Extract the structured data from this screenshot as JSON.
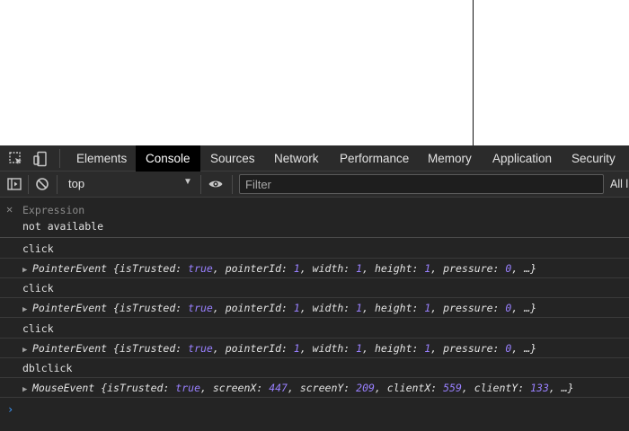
{
  "devtools": {
    "tabs": [
      {
        "label": "Elements",
        "active": false
      },
      {
        "label": "Console",
        "active": true
      },
      {
        "label": "Sources",
        "active": false
      },
      {
        "label": "Network",
        "active": false
      },
      {
        "label": "Performance",
        "active": false
      },
      {
        "label": "Memory",
        "active": false
      },
      {
        "label": "Application",
        "active": false
      },
      {
        "label": "Security",
        "active": false
      }
    ],
    "icons": {
      "inspect": "inspect-element-icon",
      "device": "device-toolbar-icon",
      "sidebar": "show-sidebar-icon",
      "clear": "clear-console-icon",
      "eye": "live-expression-eye-icon"
    }
  },
  "toolbar": {
    "context": "top",
    "filter_placeholder": "Filter",
    "levels_label": "All l"
  },
  "live_expression": {
    "label": "Expression",
    "value": "not available"
  },
  "console": {
    "messages": [
      {
        "text": "click"
      },
      {
        "object": {
          "type": "PointerEvent",
          "open": "{",
          "props": [
            {
              "k": "isTrusted",
              "v": "true"
            },
            {
              "k": "pointerId",
              "v": "1"
            },
            {
              "k": "width",
              "v": "1"
            },
            {
              "k": "height",
              "v": "1"
            },
            {
              "k": "pressure",
              "v": "0"
            }
          ],
          "close": "…}"
        }
      },
      {
        "text": "click"
      },
      {
        "object": {
          "type": "PointerEvent",
          "open": "{",
          "props": [
            {
              "k": "isTrusted",
              "v": "true"
            },
            {
              "k": "pointerId",
              "v": "1"
            },
            {
              "k": "width",
              "v": "1"
            },
            {
              "k": "height",
              "v": "1"
            },
            {
              "k": "pressure",
              "v": "0"
            }
          ],
          "close": "…}"
        }
      },
      {
        "text": "click"
      },
      {
        "object": {
          "type": "PointerEvent",
          "open": "{",
          "props": [
            {
              "k": "isTrusted",
              "v": "true"
            },
            {
              "k": "pointerId",
              "v": "1"
            },
            {
              "k": "width",
              "v": "1"
            },
            {
              "k": "height",
              "v": "1"
            },
            {
              "k": "pressure",
              "v": "0"
            }
          ],
          "close": "…}"
        }
      },
      {
        "text": "dblclick"
      },
      {
        "object": {
          "type": "MouseEvent",
          "open": "{",
          "props": [
            {
              "k": "isTrusted",
              "v": "true"
            },
            {
              "k": "screenX",
              "v": "447"
            },
            {
              "k": "screenY",
              "v": "209"
            },
            {
              "k": "clientX",
              "v": "559"
            },
            {
              "k": "clientY",
              "v": "133"
            }
          ],
          "close": "…}"
        }
      }
    ],
    "prompt_symbol": "›"
  },
  "colors": {
    "panel_bg": "#242424",
    "tab_active_bg": "#000000",
    "value_purple": "#9980ff",
    "prompt_blue": "#3d9aff"
  }
}
